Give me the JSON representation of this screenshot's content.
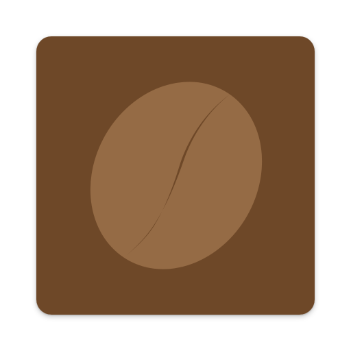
{
  "app_icon": {
    "icon": "coffee-bean-icon",
    "colors": {
      "tile": "#6E4828",
      "bean": "#956B45",
      "crease": "#6E4828"
    }
  }
}
